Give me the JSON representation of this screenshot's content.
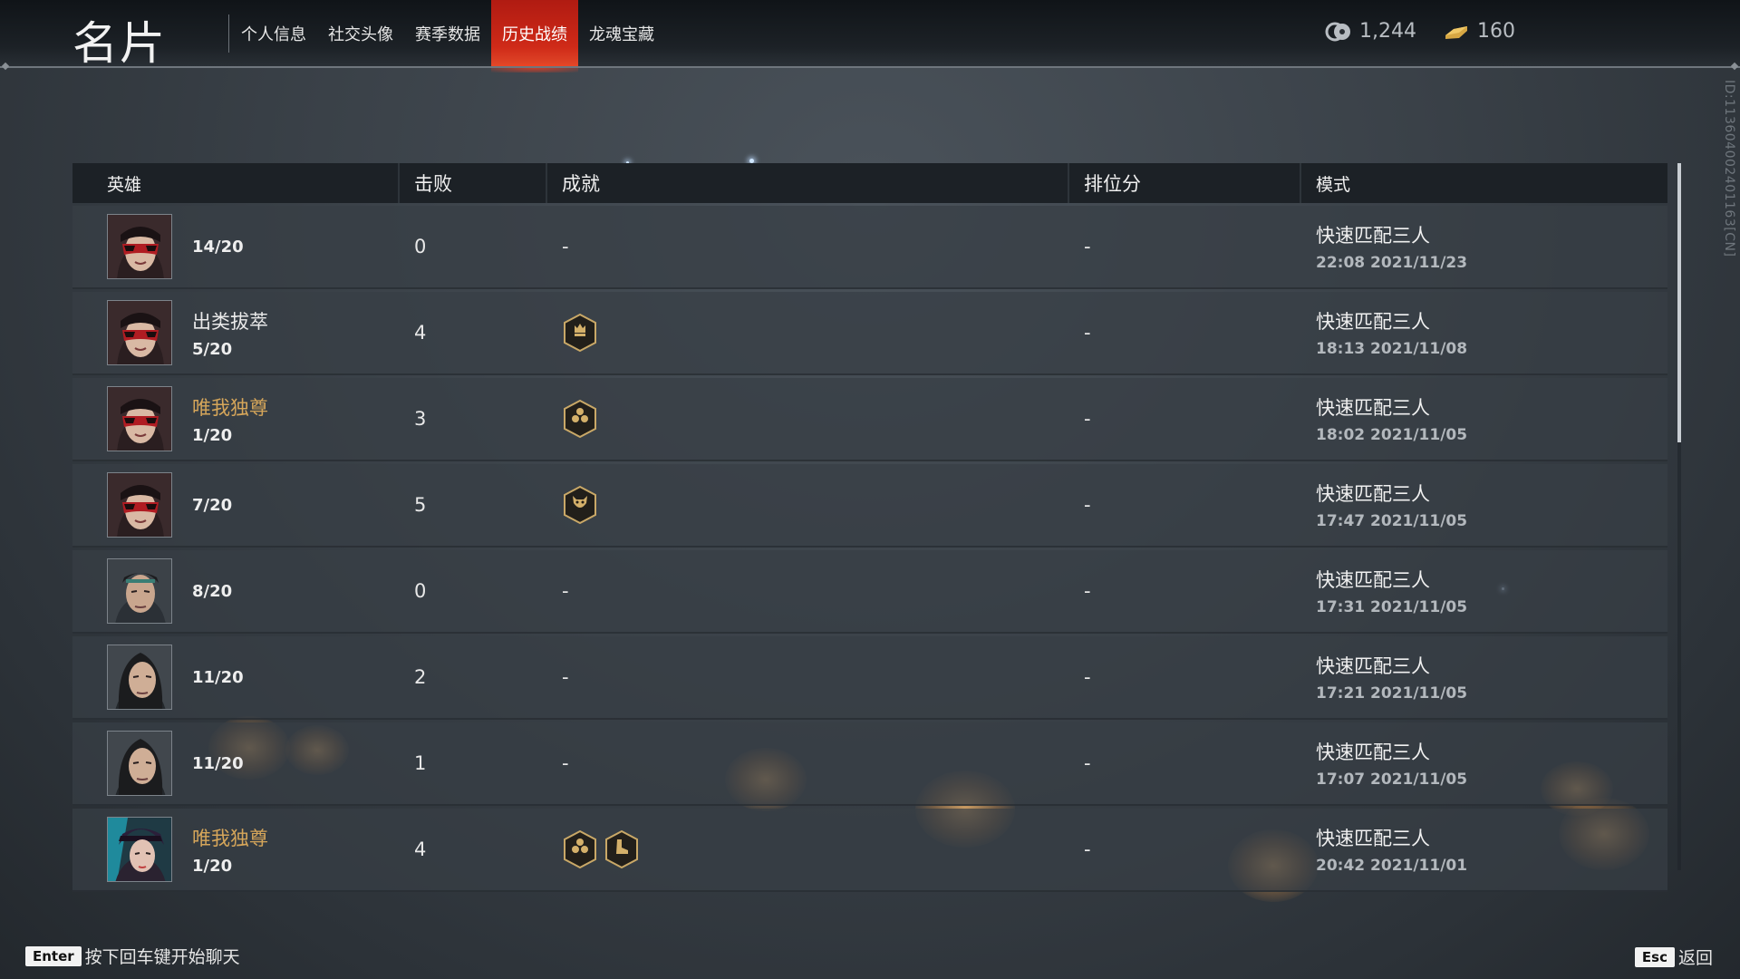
{
  "header": {
    "title": "名片",
    "tabs": [
      {
        "label": "个人信息",
        "active": false
      },
      {
        "label": "社交头像",
        "active": false
      },
      {
        "label": "赛季数据",
        "active": false
      },
      {
        "label": "历史战绩",
        "active": true
      },
      {
        "label": "龙魂宝藏",
        "active": false
      }
    ],
    "currency": [
      {
        "icon": "jade-coin-icon",
        "value": "1,244"
      },
      {
        "icon": "gold-ingot-icon",
        "value": "160"
      }
    ],
    "player_id": "ID:113604002401163[CN]"
  },
  "table": {
    "columns": [
      "英雄",
      "击败",
      "成就",
      "排位分",
      "模式"
    ],
    "rows": [
      {
        "avatar": "masked-hero-portrait",
        "title": "",
        "title_color": "white",
        "rank": "14/20",
        "kills": "0",
        "achievements": [],
        "achievement_text": "-",
        "rank_score": "-",
        "mode": "快速匹配三人",
        "time": "22:08  2021/11/23"
      },
      {
        "avatar": "masked-hero-portrait",
        "title": "出类拔萃",
        "title_color": "white",
        "rank": "5/20",
        "kills": "4",
        "achievements": [
          "crown-badge-icon"
        ],
        "achievement_text": "",
        "rank_score": "-",
        "mode": "快速匹配三人",
        "time": "18:13  2021/11/08"
      },
      {
        "avatar": "masked-hero-portrait",
        "title": "唯我独尊",
        "title_color": "gold",
        "rank": "1/20",
        "kills": "3",
        "achievements": [
          "skulls-badge-icon"
        ],
        "achievement_text": "",
        "rank_score": "-",
        "mode": "快速匹配三人",
        "time": "18:02  2021/11/05"
      },
      {
        "avatar": "masked-hero-portrait",
        "title": "",
        "title_color": "white",
        "rank": "7/20",
        "kills": "5",
        "achievements": [
          "demon-badge-icon"
        ],
        "achievement_text": "",
        "rank_score": "-",
        "mode": "快速匹配三人",
        "time": "17:47  2021/11/05"
      },
      {
        "avatar": "warrior-hero-portrait",
        "title": "",
        "title_color": "white",
        "rank": "8/20",
        "kills": "0",
        "achievements": [],
        "achievement_text": "-",
        "rank_score": "-",
        "mode": "快速匹配三人",
        "time": "17:31  2021/11/05"
      },
      {
        "avatar": "swordsman-hero-portrait",
        "title": "",
        "title_color": "white",
        "rank": "11/20",
        "kills": "2",
        "achievements": [],
        "achievement_text": "-",
        "rank_score": "-",
        "mode": "快速匹配三人",
        "time": "17:21  2021/11/05"
      },
      {
        "avatar": "swordsman-hero-portrait",
        "title": "",
        "title_color": "white",
        "rank": "11/20",
        "kills": "1",
        "achievements": [],
        "achievement_text": "-",
        "rank_score": "-",
        "mode": "快速匹配三人",
        "time": "17:07  2021/11/05"
      },
      {
        "avatar": "female-hero-portrait",
        "title": "唯我独尊",
        "title_color": "gold",
        "rank": "1/20",
        "kills": "4",
        "achievements": [
          "skulls-badge-icon",
          "boot-badge-icon"
        ],
        "achievement_text": "",
        "rank_score": "-",
        "mode": "快速匹配三人",
        "time": "20:42  2021/11/01"
      }
    ]
  },
  "footer": {
    "chat_key": "Enter",
    "chat_hint": "按下回车键开始聊天",
    "back_key": "Esc",
    "back_label": "返回"
  },
  "colors": {
    "accent_tab": "#cf2a18",
    "gold_title": "#d6a65a",
    "header_bg": "#1c2126",
    "row_bg": "#373e45"
  }
}
